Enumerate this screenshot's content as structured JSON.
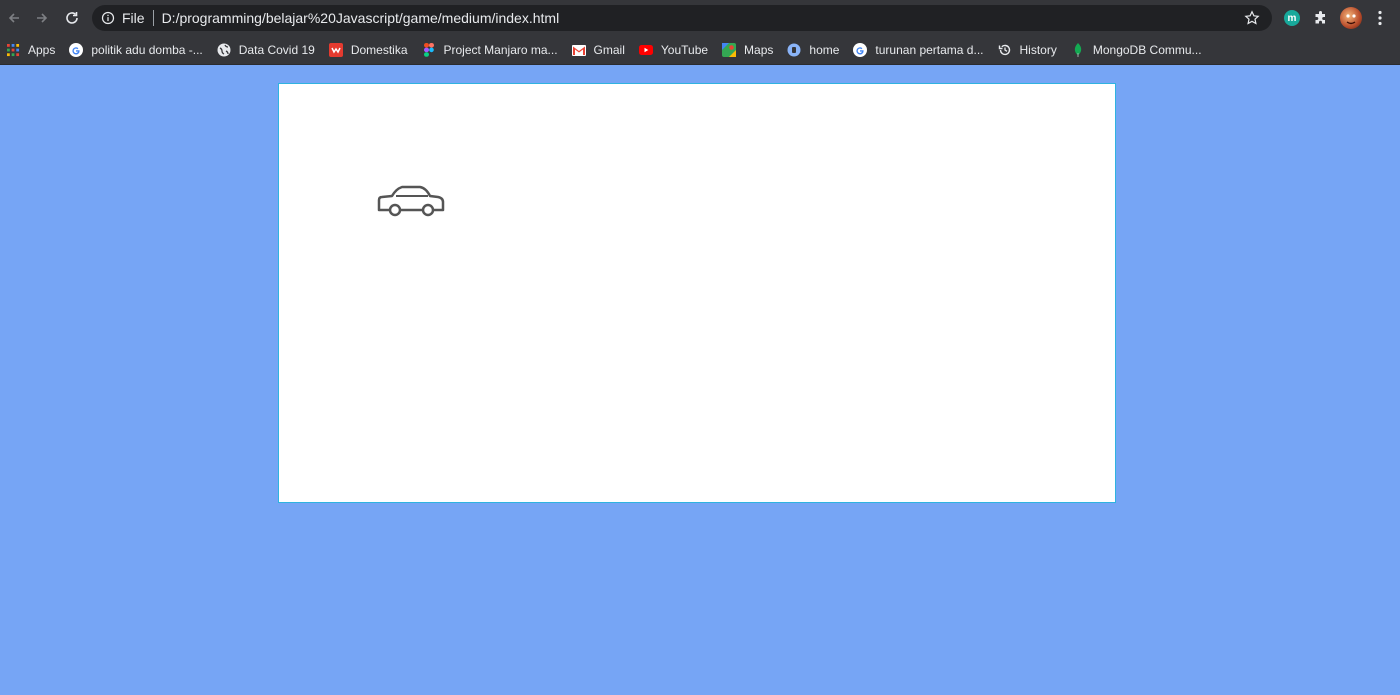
{
  "toolbar": {
    "back_icon": "arrow-left-icon",
    "forward_icon": "arrow-right-icon",
    "reload_icon": "reload-icon",
    "site_chip": "File",
    "url": "D:/programming/belajar%20Javascript/game/medium/index.html",
    "extension_badge": "m",
    "colors": {
      "bar": "#35363a",
      "omnibox": "#202124",
      "text": "#e8eaed"
    }
  },
  "bookmarks": [
    {
      "label": "Apps",
      "icon": "apps-grid-icon"
    },
    {
      "label": "politik adu domba -...",
      "icon": "google-icon"
    },
    {
      "label": "Data Covid 19",
      "icon": "globe-icon"
    },
    {
      "label": "Domestika",
      "icon": "domestika-icon"
    },
    {
      "label": "Project Manjaro ma...",
      "icon": "figma-icon"
    },
    {
      "label": "Gmail",
      "icon": "gmail-icon"
    },
    {
      "label": "YouTube",
      "icon": "youtube-icon"
    },
    {
      "label": "Maps",
      "icon": "maps-icon"
    },
    {
      "label": "home",
      "icon": "home-site-icon"
    },
    {
      "label": "turunan pertama d...",
      "icon": "google-icon"
    },
    {
      "label": "History",
      "icon": "history-icon"
    },
    {
      "label": "MongoDB Commu...",
      "icon": "mongodb-leaf-icon"
    }
  ],
  "page": {
    "background": "#76a5f5",
    "canvas_background": "#ffffff",
    "canvas_border": "#2fb3e0",
    "player_icon": "car-icon"
  }
}
